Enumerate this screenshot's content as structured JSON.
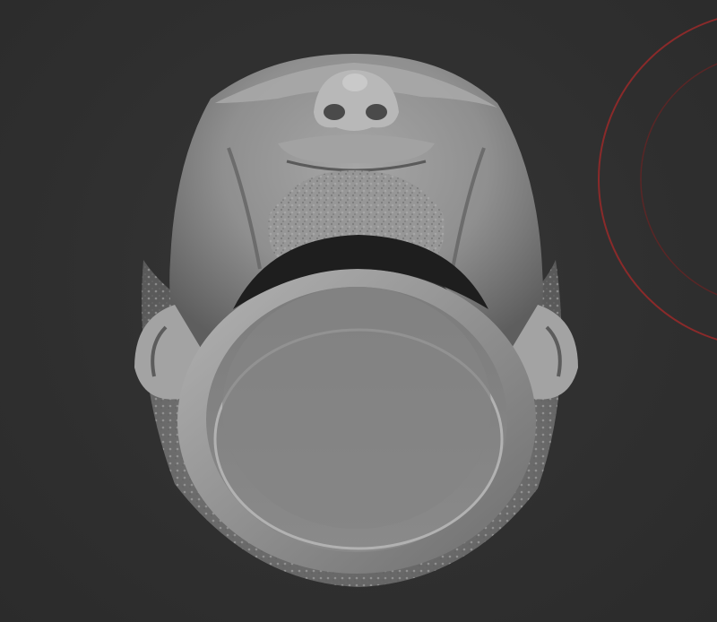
{
  "app": {
    "name": "",
    "view": "3d-viewport"
  },
  "viewport": {
    "background_color": "#2f2f2f",
    "model": {
      "label": "",
      "icon": "ring-sculpt-model",
      "material_color": "#8e8e8e"
    },
    "gizmo": {
      "icon": "rotation-gizmo-icon",
      "color": "#8a2a2a"
    }
  }
}
